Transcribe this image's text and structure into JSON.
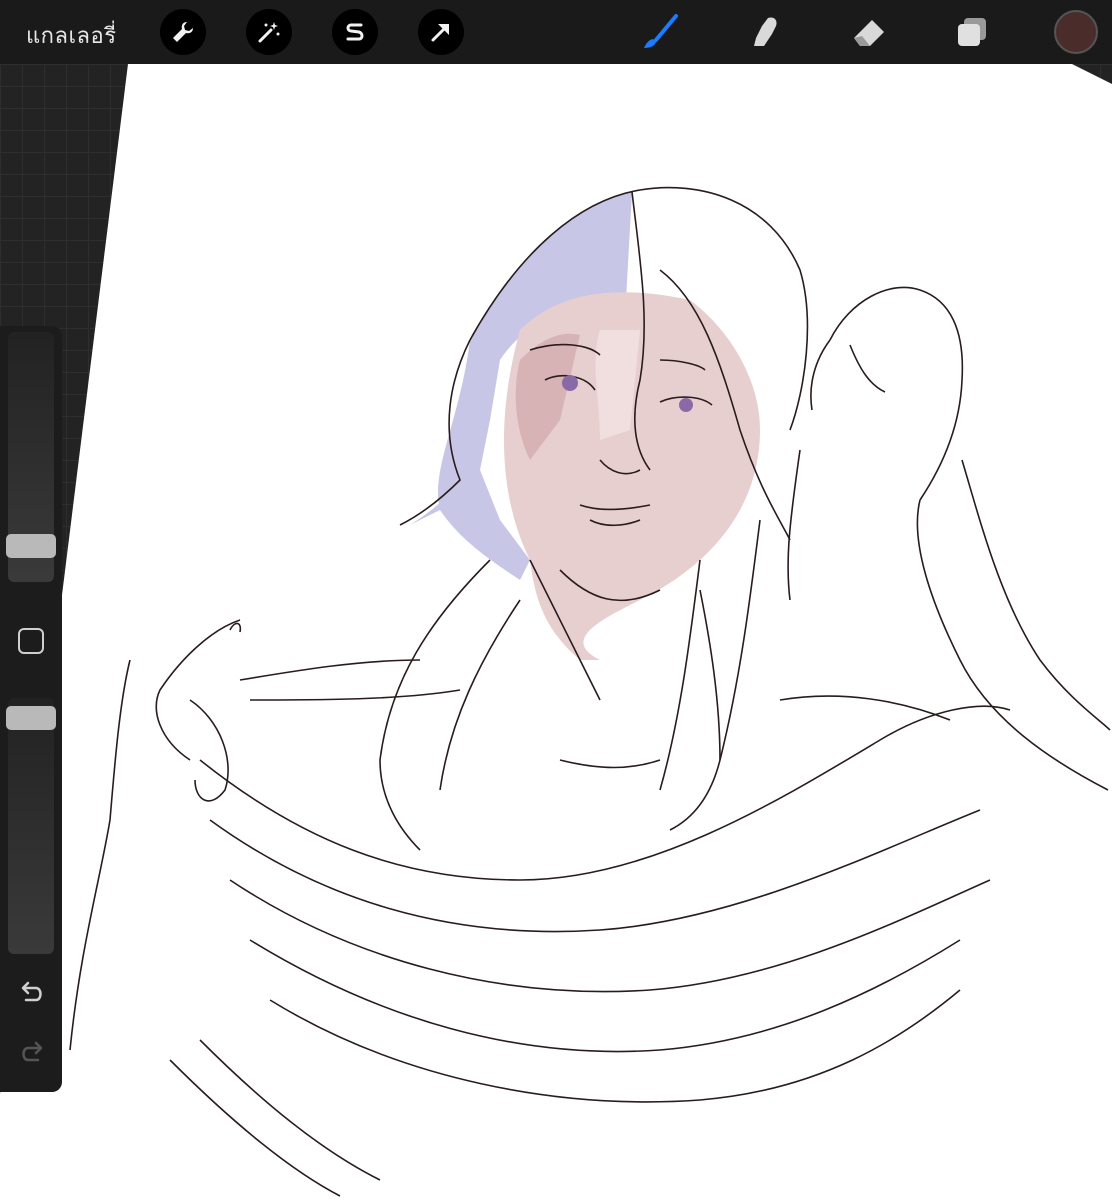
{
  "topbar": {
    "gallery_label": "แกลเลอรี่",
    "tools_left": [
      {
        "name": "actions",
        "icon": "wrench-icon"
      },
      {
        "name": "adjustments",
        "icon": "magic-wand-icon"
      },
      {
        "name": "selection",
        "icon": "selection-s-icon"
      },
      {
        "name": "transform",
        "icon": "arrow-cursor-icon"
      }
    ],
    "tools_right": [
      {
        "name": "brush",
        "icon": "brush-icon",
        "active": true,
        "color": "#1a7cff"
      },
      {
        "name": "smudge",
        "icon": "smudge-finger-icon"
      },
      {
        "name": "eraser",
        "icon": "eraser-icon"
      },
      {
        "name": "layers",
        "icon": "layers-icon"
      }
    ],
    "current_color": "#4a2d2b"
  },
  "sidebar": {
    "brush_size_level": 0.27,
    "opacity_level": 1.0,
    "undo_icon": "undo-arrow-icon",
    "redo_icon": "redo-arrow-icon",
    "modify_icon": "square-eyedropper-icon"
  },
  "canvas": {
    "artwork": "line-art-illustration"
  }
}
